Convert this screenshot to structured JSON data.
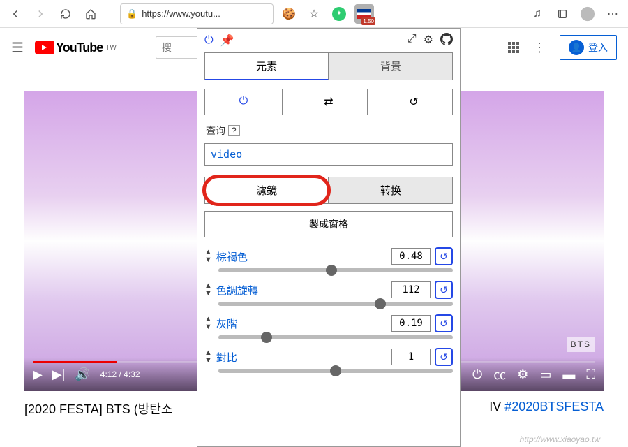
{
  "browser": {
    "url": "https://www.youtu...",
    "ext_badge": "1.50"
  },
  "youtube": {
    "brand": "YouTube",
    "region": "TW",
    "search_placeholder": "搜",
    "login": "登入",
    "video_time": "4:12 / 4:32",
    "bts": "BTS",
    "title_left": "[2020 FESTA] BTS (방탄소",
    "title_right_plain": "IV ",
    "title_hashtag": "#2020BTSFESTA"
  },
  "ext": {
    "tabs": {
      "elements": "元素",
      "background": "背景"
    },
    "query_label": "查询",
    "help": "?",
    "query_value": "video",
    "subtabs": {
      "filter": "濾鏡",
      "transform": "转换"
    },
    "grid_btn": "製成窗格",
    "filters": [
      {
        "name": "棕褐色",
        "value": "0.48",
        "slider": 48
      },
      {
        "name": "色調旋轉",
        "value": "112",
        "slider": 70
      },
      {
        "name": "灰階",
        "value": "0.19",
        "slider": 19
      },
      {
        "name": "對比",
        "value": "1",
        "slider": 50
      }
    ]
  },
  "watermark": "http://www.xiaoyao.tw"
}
